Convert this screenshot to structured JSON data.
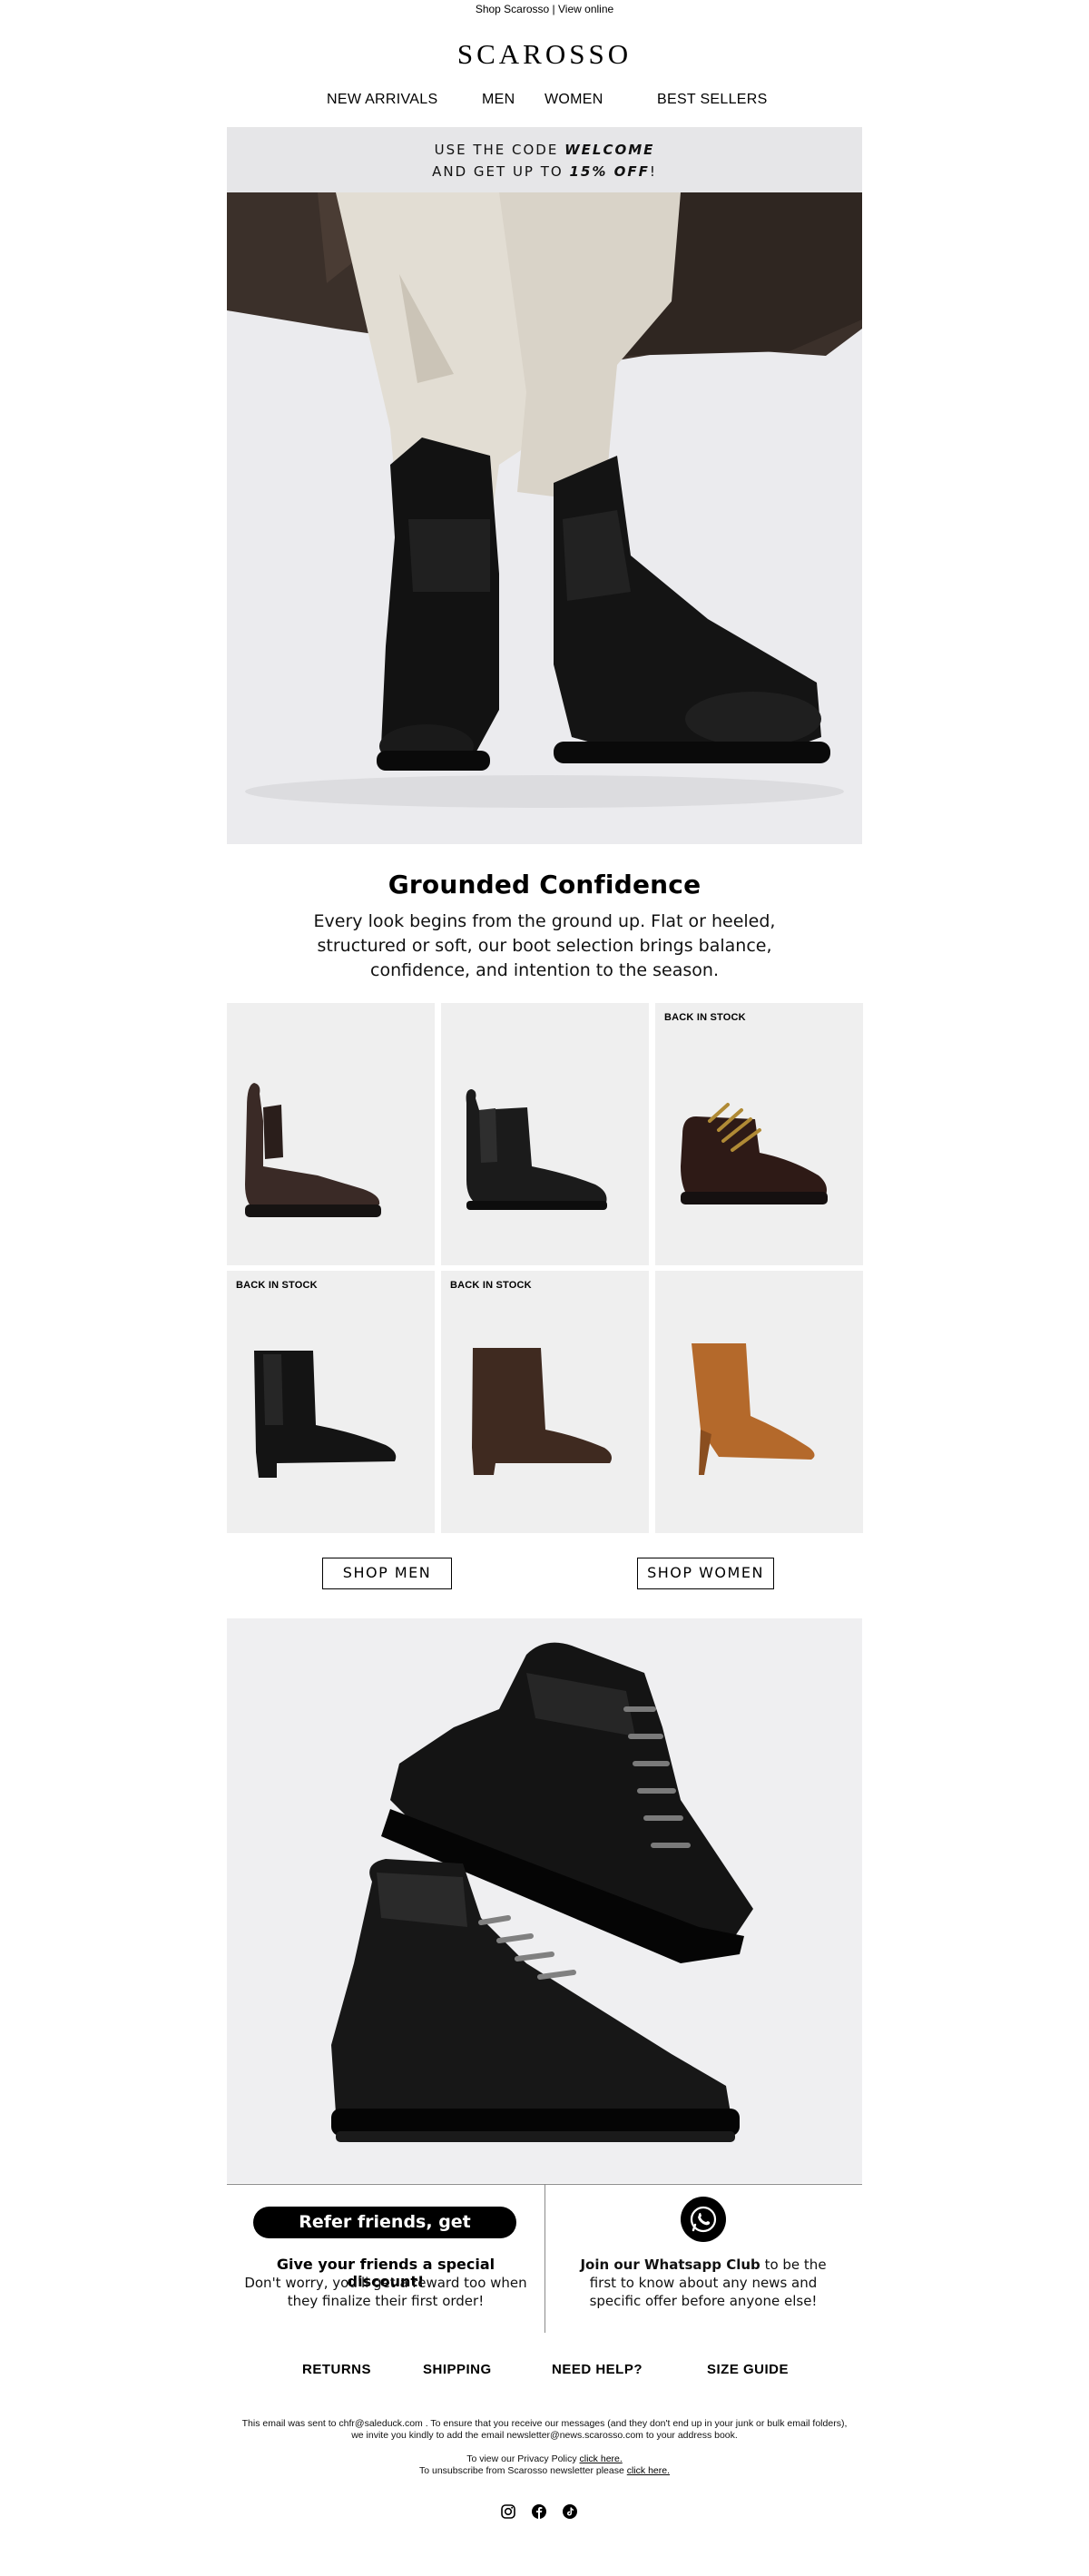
{
  "preheader": {
    "shop": "Shop Scarosso",
    "separator": "|",
    "view_online": "View online"
  },
  "brand": {
    "logo_text": "SCAROSSO"
  },
  "nav": [
    {
      "label": "NEW ARRIVALS"
    },
    {
      "label": "MEN"
    },
    {
      "label": "WOMEN"
    },
    {
      "label": "BEST SELLERS"
    }
  ],
  "promo": {
    "line1_prefix": "USE THE CODE ",
    "code": "WELCOME",
    "line2_prefix": "AND GET UP TO ",
    "discount": "15% OFF",
    "line2_suffix": "!"
  },
  "hero": {
    "alt": "Legs in cream trousers and a brown coat wearing black leather Chelsea boots"
  },
  "section": {
    "headline": "Grounded Confidence",
    "body": "Every look begins from the ground up. Flat or heeled, structured or soft, our boot selection brings balance, confidence, and intention to the season."
  },
  "products": [
    {
      "badge": "",
      "kind": "dark-brown-chelsea-brogue"
    },
    {
      "badge": "",
      "kind": "black-suede-chelsea"
    },
    {
      "badge": "BACK IN STOCK",
      "kind": "brown-lace-hiker"
    },
    {
      "badge": "BACK IN STOCK",
      "kind": "black-heeled-chelsea"
    },
    {
      "badge": "BACK IN STOCK",
      "kind": "brown-suede-ankle-boot"
    },
    {
      "badge": "",
      "kind": "tan-suede-kitten-heel"
    }
  ],
  "buttons": {
    "shop_men": "SHOP MEN",
    "shop_women": "SHOP WOMEN"
  },
  "hero2": {
    "alt": "Two stacked black leather lace-up boots"
  },
  "referral": {
    "pill": "Refer friends, get rewards!",
    "title": "Give your friends a special discount!",
    "text": "Don't worry, you'll get a reward too when they finalize their first order!"
  },
  "whatsapp": {
    "bold": "Join our Whatsapp Club",
    "text": " to be the first to know about any news and specific offer before anyone else!"
  },
  "footer_links": [
    {
      "label": "RETURNS"
    },
    {
      "label": "SHIPPING"
    },
    {
      "label": "NEED HELP?"
    },
    {
      "label": "SIZE GUIDE"
    }
  ],
  "legal": {
    "line1": "This email was sent to chfr@saleduck.com . To ensure that you receive our messages (and they don't end up in your junk or bulk email folders),",
    "line2": "we invite you kindly to add the email newsletter@news.scarosso.com to your address book.",
    "privacy_prefix": "To view our Privacy Policy ",
    "privacy_link": "click here.",
    "unsub_prefix": "To unsubscribe from Scarosso newsletter please ",
    "unsub_link": "click here."
  },
  "social": [
    "instagram-icon",
    "facebook-icon",
    "tiktok-icon"
  ],
  "colors": {
    "banner_bg": "#e6e6e8",
    "tile_bg": "#efefef",
    "black": "#000000"
  }
}
